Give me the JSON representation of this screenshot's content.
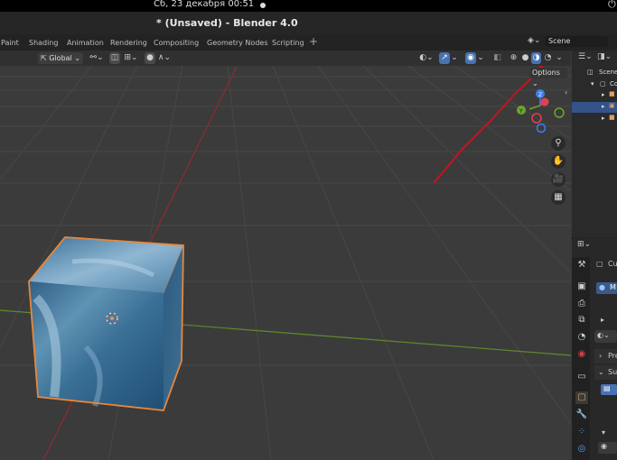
{
  "system_bar": {
    "datetime": "Сб, 23 декабря  00:51"
  },
  "window": {
    "title": "* (Unsaved) - Blender 4.0"
  },
  "workspace_tabs": [
    "Paint",
    "Shading",
    "Animation",
    "Rendering",
    "Compositing",
    "Geometry Nodes",
    "Scripting"
  ],
  "scene": {
    "name": "Scene"
  },
  "viewport_header": {
    "transform_orientation": "Global",
    "options_label": "Options"
  },
  "outliner": {
    "scene_collection": "Scene",
    "collection_abbrev": "Co"
  },
  "properties": {
    "object_abbrev": "Cu",
    "material_abbrev": "M",
    "panel_preview": "Pre",
    "panel_surface": "Sur"
  },
  "colors": {
    "annotation": "#c0161e",
    "selection_outline": "#e8873a",
    "axis_x": "#8f2a36",
    "axis_y": "#5f8a2b",
    "gizmo_x": "#e3404f",
    "gizmo_y": "#6aa62b",
    "gizmo_z": "#3f7ef0"
  }
}
